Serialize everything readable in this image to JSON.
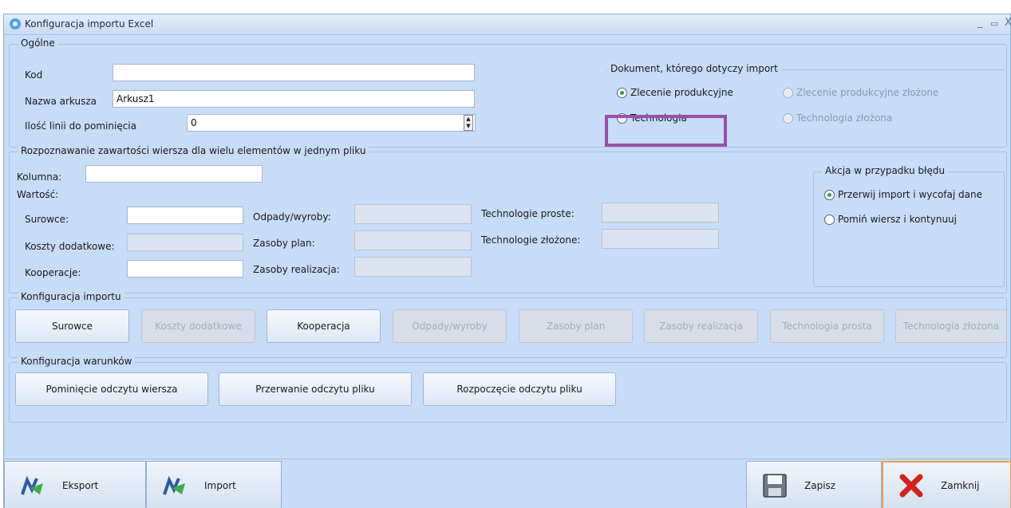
{
  "window": {
    "title": "Konfiguracja importu Excel",
    "minimize": "_",
    "maximize": "▭",
    "close": "X"
  },
  "general": {
    "legend": "Ogólne",
    "kod_label": "Kod",
    "kod_value": "",
    "sheet_label": "Nazwa arkusza",
    "sheet_value": "Arkusz1",
    "skip_label": "Ilość linii do pominięcia",
    "skip_value": "0"
  },
  "document": {
    "legend": "Dokument, którego dotyczy import",
    "options": [
      {
        "label": "Zlecenie produkcyjne",
        "checked": true,
        "enabled": true
      },
      {
        "label": "Zlecenie produkcyjne złożone",
        "checked": false,
        "enabled": false
      },
      {
        "label": "Technologia",
        "checked": false,
        "enabled": true
      },
      {
        "label": "Technologia złożona",
        "checked": false,
        "enabled": false
      }
    ]
  },
  "recognition": {
    "legend": "Rozpoznawanie zawartości wiersza dla wielu elementów w jednym pliku",
    "column_label": "Kolumna:",
    "value_label": "Wartość:",
    "fields": {
      "surowce": "Surowce:",
      "koszty": "Koszty dodatkowe:",
      "kooperacje": "Kooperacje:",
      "odpady": "Odpady/wyroby:",
      "zasoby_plan": "Zasoby plan:",
      "zasoby_realizacja": "Zasoby realizacja:",
      "tech_proste": "Technologie proste:",
      "tech_zlozone": "Technologie złożone:"
    }
  },
  "error_action": {
    "legend": "Akcja w przypadku błędu",
    "options": [
      {
        "label": "Przerwij import i wycofaj dane",
        "checked": true
      },
      {
        "label": "Pomiń wiersz i kontynuuj",
        "checked": false
      }
    ]
  },
  "import_config": {
    "legend": "Konfiguracja importu",
    "buttons": [
      {
        "label": "Surowce",
        "enabled": true
      },
      {
        "label": "Koszty dodatkowe",
        "enabled": false
      },
      {
        "label": "Kooperacja",
        "enabled": true
      },
      {
        "label": "Odpady/wyroby",
        "enabled": false
      },
      {
        "label": "Zasoby plan",
        "enabled": false
      },
      {
        "label": "Zasoby realizacja",
        "enabled": false
      },
      {
        "label": "Technologia prosta",
        "enabled": false
      },
      {
        "label": "Technologia złożona",
        "enabled": false
      }
    ]
  },
  "conditions": {
    "legend": "Konfiguracja warunków",
    "buttons": [
      "Pominięcie odczytu wiersza",
      "Przerwanie odczytu pliku",
      "Rozpoczęcie odczytu pliku"
    ]
  },
  "footer": {
    "export": "Eksport",
    "import": "Import",
    "save": "Zapisz",
    "close": "Zamknij"
  }
}
